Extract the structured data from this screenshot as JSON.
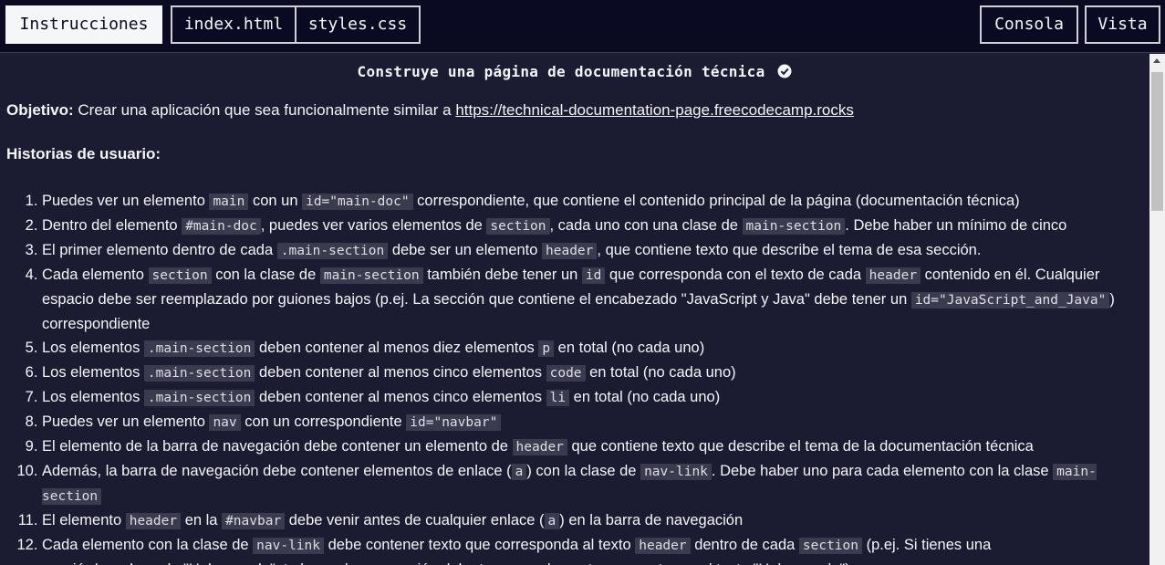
{
  "topbar": {
    "tab_instructions": "Instrucciones",
    "tab_index": "index.html",
    "tab_styles": "styles.css",
    "console_label": "Consola",
    "preview_label": "Vista"
  },
  "title": "Construye una página de documentación técnica",
  "objective": {
    "label": "Objetivo:",
    "text": "Crear una aplicación que sea funcionalmente similar a",
    "link": "https://technical-documentation-page.freecodecamp.rocks"
  },
  "stories_heading": "Historias de usuario:",
  "stories": [
    [
      {
        "t": "Puedes ver un elemento "
      },
      {
        "c": "main"
      },
      {
        "t": " con un "
      },
      {
        "c": "id=\"main-doc\""
      },
      {
        "t": " correspondiente, que contiene el contenido principal de la página (documentación técnica)"
      }
    ],
    [
      {
        "t": "Dentro del elemento "
      },
      {
        "c": "#main-doc"
      },
      {
        "t": ", puedes ver varios elementos de "
      },
      {
        "c": "section"
      },
      {
        "t": ", cada uno con una clase de "
      },
      {
        "c": "main-section"
      },
      {
        "t": ". Debe haber un mínimo de cinco"
      }
    ],
    [
      {
        "t": "El primer elemento dentro de cada "
      },
      {
        "c": ".main-section"
      },
      {
        "t": " debe ser un elemento "
      },
      {
        "c": "header"
      },
      {
        "t": ", que contiene texto que describe el tema de esa sección."
      }
    ],
    [
      {
        "t": "Cada elemento "
      },
      {
        "c": "section"
      },
      {
        "t": " con la clase de "
      },
      {
        "c": "main-section"
      },
      {
        "t": " también debe tener un "
      },
      {
        "c": "id"
      },
      {
        "t": " que corresponda con el texto de cada "
      },
      {
        "c": "header"
      },
      {
        "t": " contenido en él. Cualquier espacio debe ser reemplazado por guiones bajos (p.ej. La sección que contiene el encabezado \"JavaScript y Java\" debe tener un "
      },
      {
        "c": "id=\"JavaScript_and_Java\""
      },
      {
        "t": ") correspondiente"
      }
    ],
    [
      {
        "t": "Los elementos "
      },
      {
        "c": ".main-section"
      },
      {
        "t": " deben contener al menos diez elementos "
      },
      {
        "c": "p"
      },
      {
        "t": " en total (no cada uno)"
      }
    ],
    [
      {
        "t": "Los elementos "
      },
      {
        "c": ".main-section"
      },
      {
        "t": " deben contener al menos cinco elementos "
      },
      {
        "c": "code"
      },
      {
        "t": " en total (no cada uno)"
      }
    ],
    [
      {
        "t": "Los elementos "
      },
      {
        "c": ".main-section"
      },
      {
        "t": " deben contener al menos cinco elementos "
      },
      {
        "c": "li"
      },
      {
        "t": " en total (no cada uno)"
      }
    ],
    [
      {
        "t": "Puedes ver un elemento "
      },
      {
        "c": "nav"
      },
      {
        "t": " con un correspondiente "
      },
      {
        "c": "id=\"navbar\""
      }
    ],
    [
      {
        "t": "El elemento de la barra de navegación debe contener un elemento de "
      },
      {
        "c": "header"
      },
      {
        "t": " que contiene texto que describe el tema de la documentación técnica"
      }
    ],
    [
      {
        "t": "Además, la barra de navegación debe contener elementos de enlace ("
      },
      {
        "c": "a"
      },
      {
        "t": ") con la clase de "
      },
      {
        "c": "nav-link"
      },
      {
        "t": ". Debe haber uno para cada elemento con la clase "
      },
      {
        "c": "main-section"
      }
    ],
    [
      {
        "t": "El elemento "
      },
      {
        "c": "header"
      },
      {
        "t": " en la "
      },
      {
        "c": "#navbar"
      },
      {
        "t": " debe venir antes de cualquier enlace ("
      },
      {
        "c": "a"
      },
      {
        "t": ") en la barra de navegación"
      }
    ],
    [
      {
        "t": "Cada elemento con la clase de "
      },
      {
        "c": "nav-link"
      },
      {
        "t": " debe contener texto que corresponda al texto "
      },
      {
        "c": "header"
      },
      {
        "t": " dentro de cada "
      },
      {
        "c": "section"
      },
      {
        "t": " (p.ej. Si tienes una sección/encabezado \"Hola mundo\", tu barra de navegación debe tener un elemento que contenga el texto \"Hola mundo\")"
      }
    ]
  ],
  "colors": {
    "background": "#1b1b32",
    "topbar": "#0a0a23",
    "code_bg": "#3b3b4f",
    "text": "#f5f6f7"
  },
  "icons": {
    "title_check": "check-circle-icon",
    "scroll_up": "scroll-up-arrow-icon"
  }
}
